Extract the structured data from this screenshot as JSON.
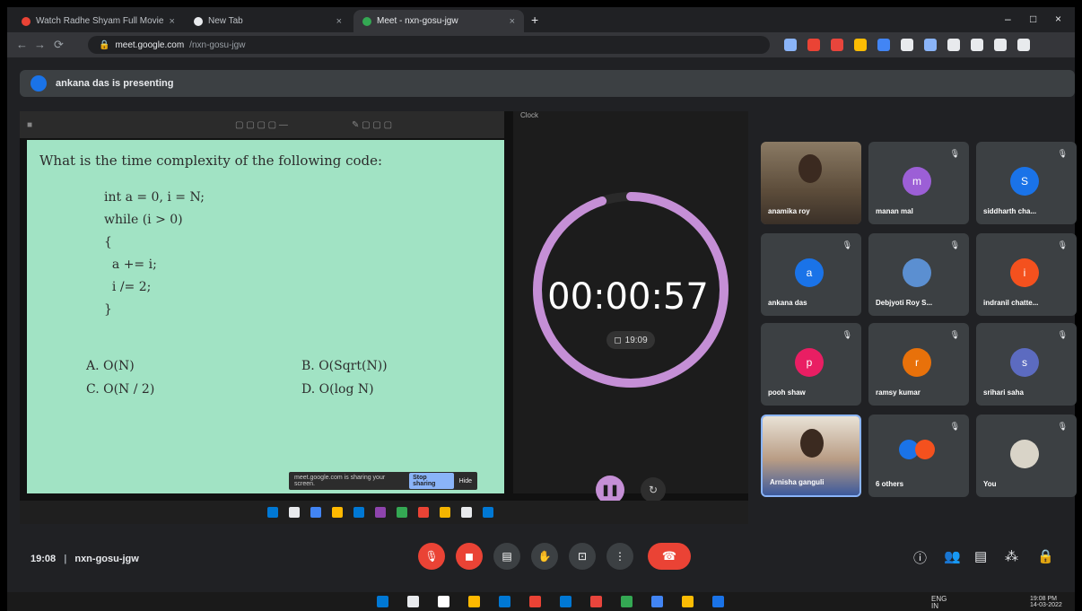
{
  "browser": {
    "tabs": [
      {
        "label": "Watch Radhe Shyam Full Movie",
        "active": false,
        "dot": "#ea4335"
      },
      {
        "label": "New Tab",
        "active": false,
        "dot": "#e8eaed"
      },
      {
        "label": "Meet - nxn-gosu-jgw",
        "active": true,
        "dot": "#34a853"
      }
    ],
    "new_tab": "+",
    "url_host": "meet.google.com",
    "url_path": "/nxn-gosu-jgw",
    "window_min": "–",
    "window_max": "□",
    "window_close": "×",
    "ext_colors": [
      "#8ab4f8",
      "#ea4335",
      "#e8453c",
      "#fbbc04",
      "#4285f4",
      "#e8eaed",
      "#8ab4f8",
      "#e8eaed",
      "#e8eaed",
      "#e8eaed",
      "#e8eaed"
    ]
  },
  "presenting_bar": {
    "text": "ankana das is presenting"
  },
  "slide": {
    "question": "What is the time complexity of the following code:",
    "code": [
      "int a = 0, i = N;",
      "while (i > 0)",
      "{",
      "  a += i;",
      "  i /= 2;",
      "}"
    ],
    "options": {
      "a": "A. O(N)",
      "b": "B. O(Sqrt(N))",
      "c": "C. O(N / 2)",
      "d": "D. O(log N)"
    }
  },
  "share_notice": {
    "text": "meet.google.com is sharing your screen.",
    "stop_label": "Stop sharing",
    "hide_label": "Hide"
  },
  "clock_app": {
    "title": "Clock",
    "elapsed": "00:00:57",
    "alarm_time": "19:09",
    "progress": 0.95,
    "ring_color": "#c58fd6"
  },
  "participants": [
    {
      "name": "anamika roy",
      "initial": "",
      "color": "",
      "video": true
    },
    {
      "name": "manan mal",
      "initial": "m",
      "color": "#9c5fd6",
      "video": false
    },
    {
      "name": "siddharth cha...",
      "initial": "S",
      "color": "#1a73e8",
      "video": false
    },
    {
      "name": "ankana das",
      "initial": "a",
      "color": "#1a73e8",
      "video": false
    },
    {
      "name": "Debjyoti Roy S...",
      "initial": "",
      "color": "#5b8fd1",
      "video": false
    },
    {
      "name": "indranil chatte...",
      "initial": "i",
      "color": "#f4511e",
      "video": false
    },
    {
      "name": "pooh shaw",
      "initial": "p",
      "color": "#e91e63",
      "video": false
    },
    {
      "name": "ramsy kumar",
      "initial": "r",
      "color": "#e8710a",
      "video": false
    },
    {
      "name": "srihari saha",
      "initial": "s",
      "color": "#5c6bc0",
      "video": false
    },
    {
      "name": "Arnisha ganguli",
      "initial": "",
      "color": "",
      "video": true
    },
    {
      "name": "6 others",
      "initial": "",
      "color": "",
      "video": false
    },
    {
      "name": "You",
      "initial": "",
      "color": "",
      "video": false
    }
  ],
  "meeting": {
    "time": "19:08",
    "code": "nxn-gosu-jgw",
    "separator": "|"
  },
  "taskbar": {
    "time": "19:08 PM",
    "date": "14-03-2022",
    "lang": "ENG\nIN"
  }
}
